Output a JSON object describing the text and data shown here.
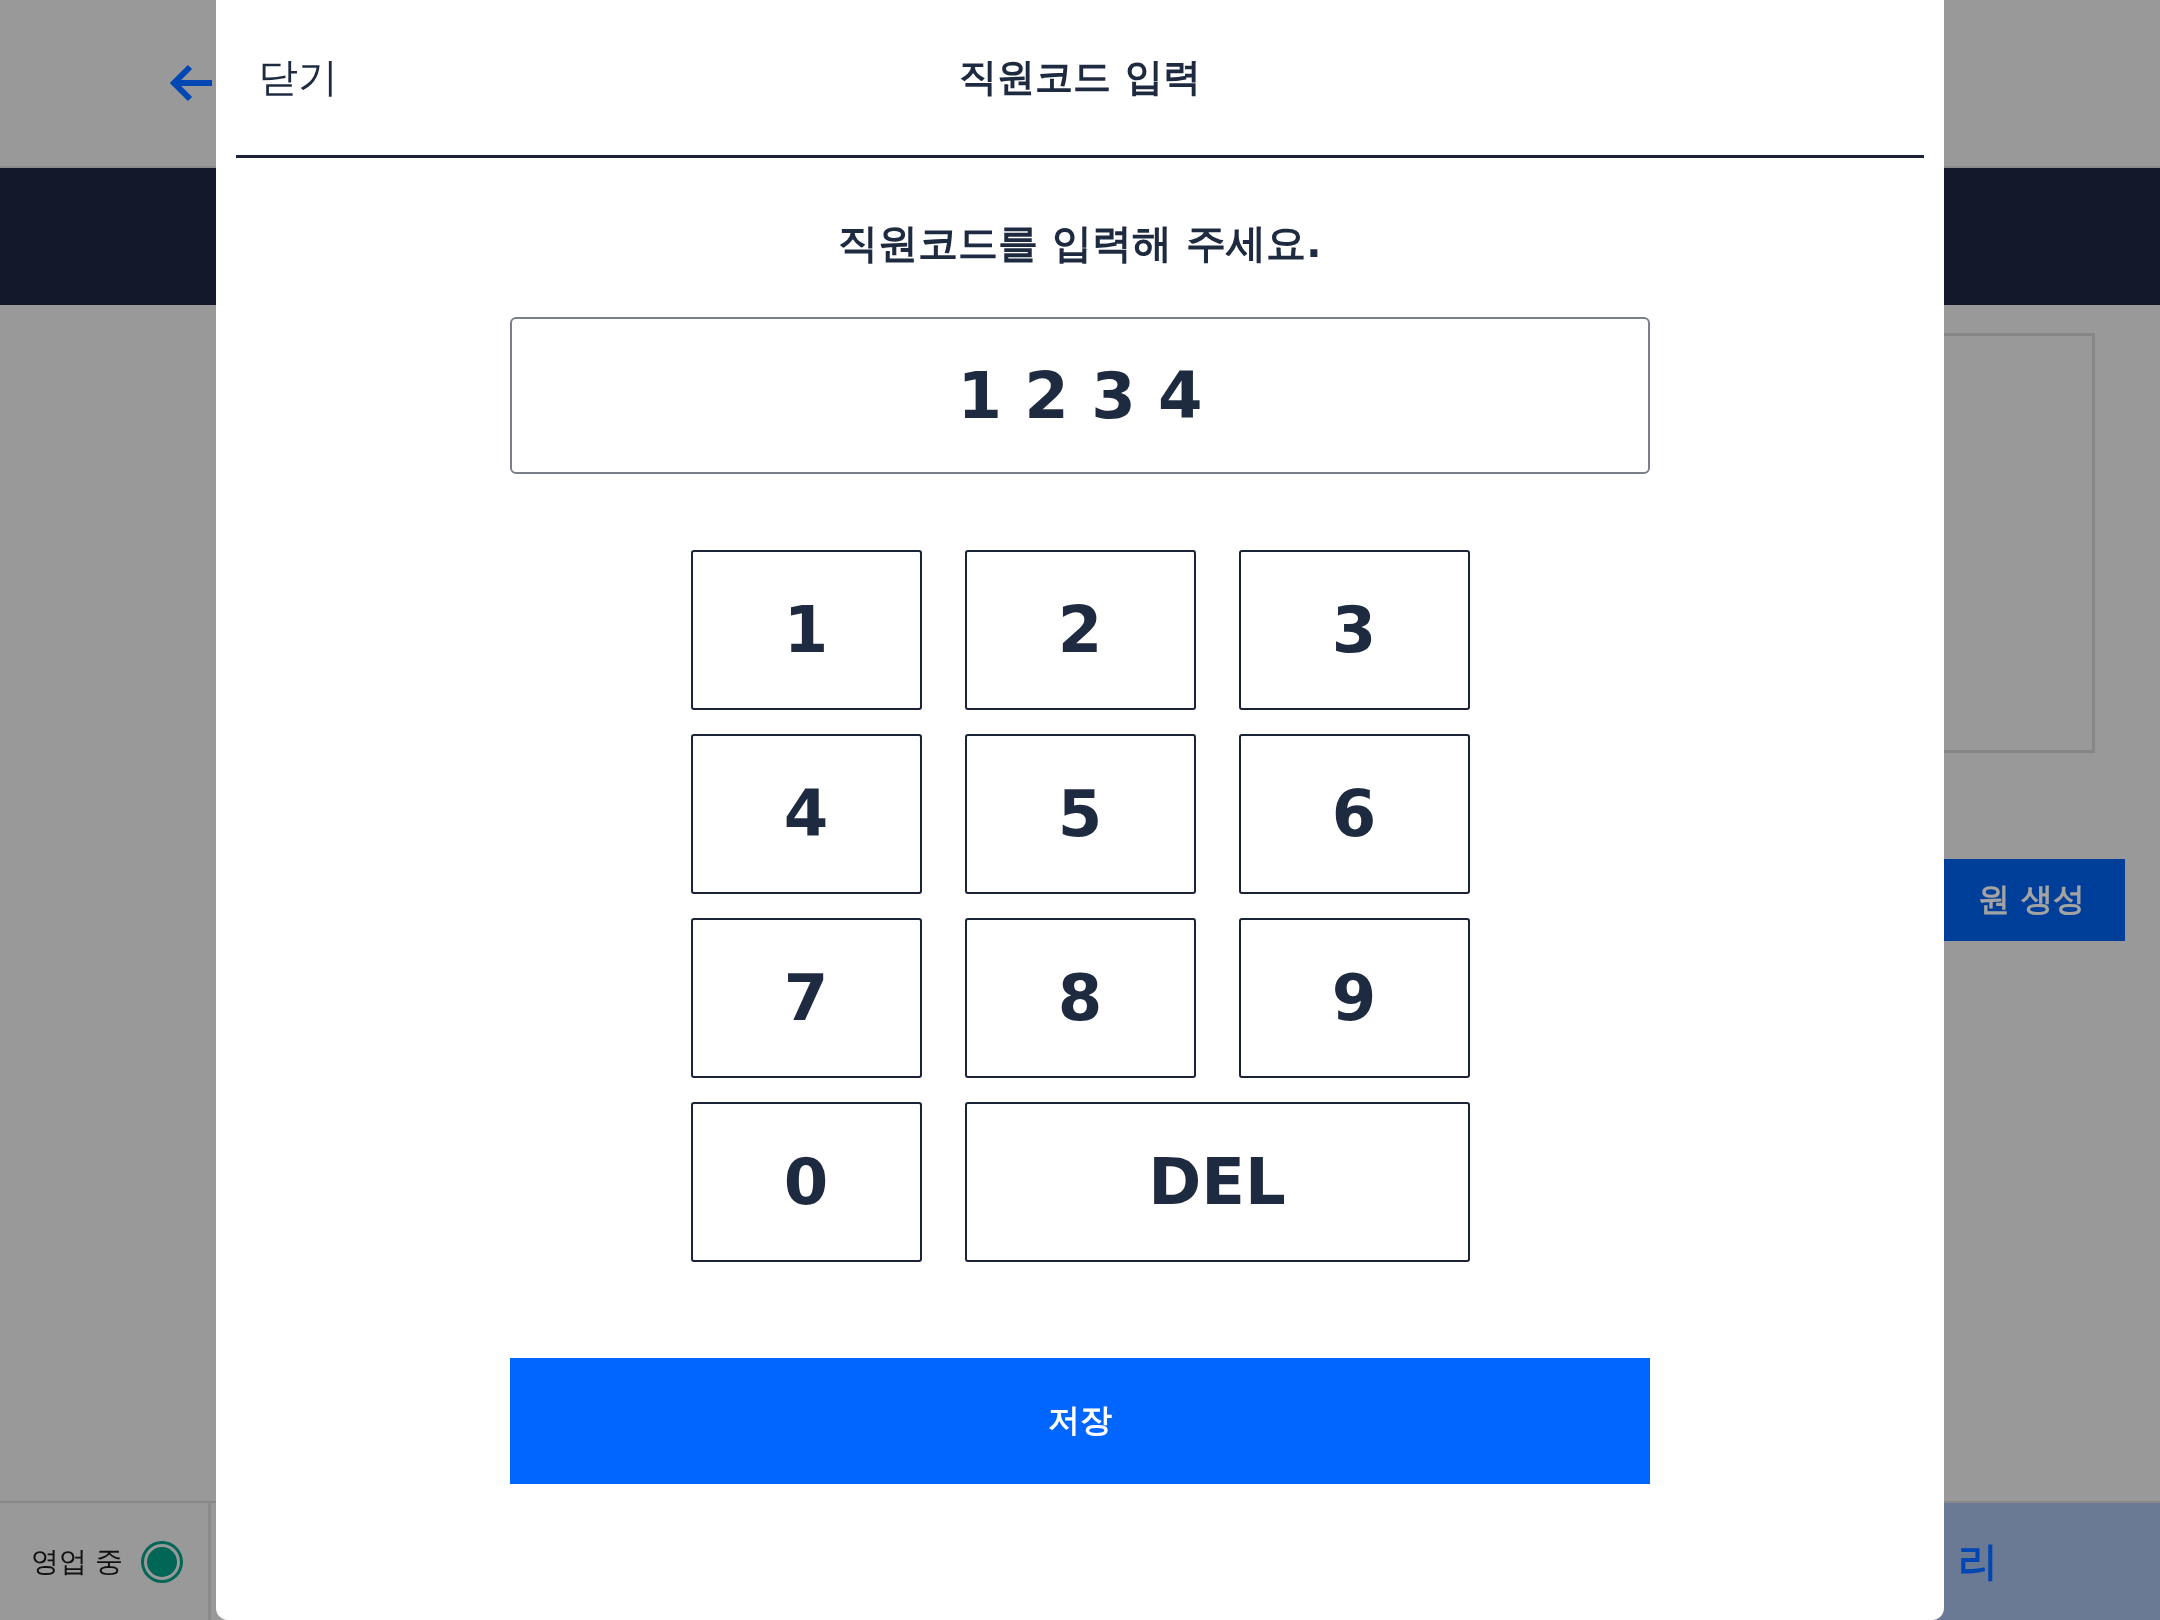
{
  "background": {
    "status_label": "영업 중",
    "create_button": "원 생성",
    "bottom_right_label": "리"
  },
  "dialog": {
    "close": "닫기",
    "title": "직원코드 입력",
    "prompt": "직원코드를 입력해 주세요.",
    "code_value": "1 2 3 4",
    "keys": [
      {
        "label": "1",
        "kind": "digit"
      },
      {
        "label": "2",
        "kind": "digit"
      },
      {
        "label": "3",
        "kind": "digit"
      },
      {
        "label": "4",
        "kind": "digit"
      },
      {
        "label": "5",
        "kind": "digit"
      },
      {
        "label": "6",
        "kind": "digit"
      },
      {
        "label": "7",
        "kind": "digit"
      },
      {
        "label": "8",
        "kind": "digit"
      },
      {
        "label": "9",
        "kind": "digit"
      },
      {
        "label": "0",
        "kind": "digit"
      },
      {
        "label": "DEL",
        "kind": "delete"
      }
    ],
    "save_button": "저장"
  }
}
